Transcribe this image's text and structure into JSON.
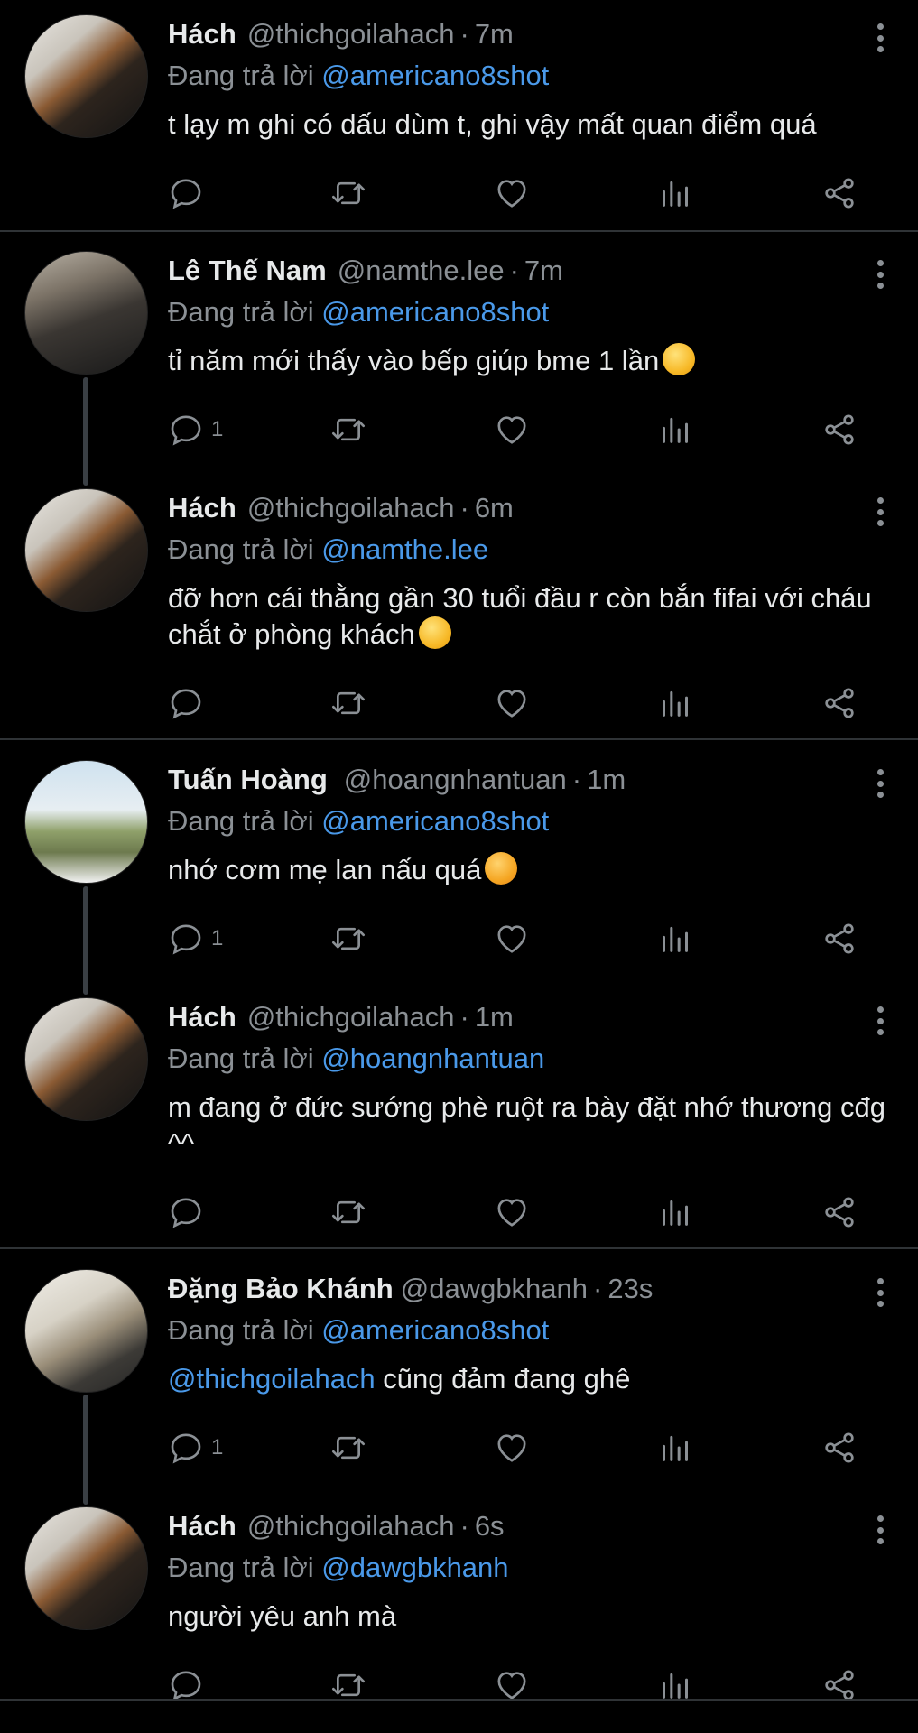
{
  "replying_prefix": "Đang trả lời",
  "colors": {
    "background": "#000000",
    "text": "#e7e9ea",
    "muted": "#8b9095",
    "link": "#4a99e9",
    "divider": "#2f3336"
  },
  "icons": {
    "reply": "reply-icon",
    "retweet": "retweet-icon",
    "like": "heart-icon",
    "views": "analytics-icon",
    "share": "share-icon",
    "more": "more-vertical-icon"
  },
  "tweets": [
    {
      "name": "Hách",
      "handle": "@thichgoilahach",
      "time": "7m",
      "reply_to": "@americano8shot",
      "text": "t lạy m ghi có dấu dùm t, ghi vậy mất quan điểm quá",
      "reply_count": ""
    },
    {
      "name": "Lê Thế Nam",
      "handle": "@namthe.lee",
      "time": "7m",
      "reply_to": "@americano8shot",
      "text": "tỉ năm mới thấy vào bếp giúp bme 1 lần",
      "reply_count": "1",
      "emoji": "zany-face-emoji"
    },
    {
      "name": "Hách",
      "handle": "@thichgoilahach",
      "time": "6m",
      "reply_to": "@namthe.lee",
      "text": "đỡ hơn cái thằng gần 30 tuổi đầu r còn bắn fifai với cháu chắt ở phòng khách",
      "reply_count": "",
      "emoji": "zany-face-emoji"
    },
    {
      "name": "Tuấn Hoàng",
      "handle": "@hoangnhantuan",
      "time": "1m",
      "reply_to": "@americano8shot",
      "text": "nhớ cơm mẹ lan nấu quá",
      "reply_count": "1",
      "emoji": "smiling-face-with-hearts-emoji"
    },
    {
      "name": "Hách",
      "handle": "@thichgoilahach",
      "time": "1m",
      "reply_to": "@hoangnhantuan",
      "text": "m đang ở đức sướng phè ruột ra bày đặt nhớ thương cđg ^^",
      "reply_count": ""
    },
    {
      "name": "Đặng Bảo Khánh",
      "handle": "@dawgbkhanh",
      "time": "23s",
      "reply_to": "@americano8shot",
      "text_mention": "@thichgoilahach",
      "text": " cũng đảm đang ghê",
      "reply_count": "1"
    },
    {
      "name": "Hách",
      "handle": "@thichgoilahach",
      "time": "6s",
      "reply_to": "@dawgbkhanh",
      "text": "người yêu anh mà",
      "reply_count": ""
    }
  ]
}
